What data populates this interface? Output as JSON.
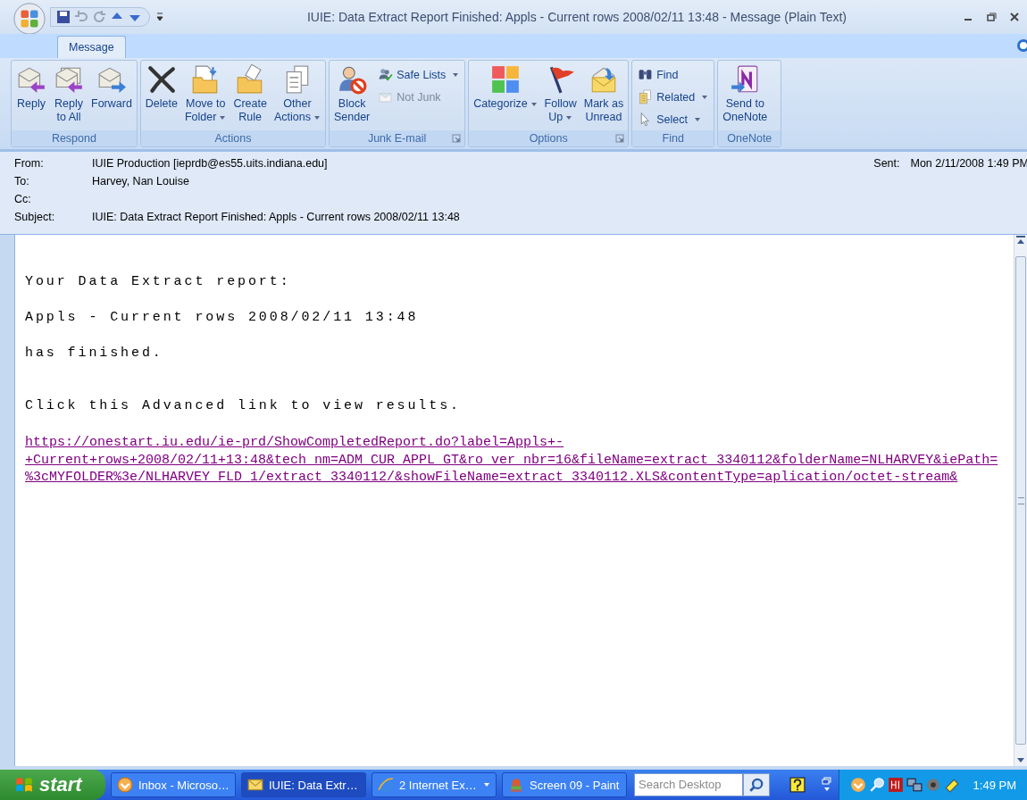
{
  "window": {
    "title": "IUIE: Data Extract Report Finished: Appls - Current rows 2008/02/11 13:48  - Message (Plain Text)"
  },
  "tabs": [
    {
      "label": "Message",
      "selected": true
    }
  ],
  "ribbon": [
    {
      "name": "Respond",
      "launcher": false,
      "buttons": [
        {
          "kind": "large",
          "label": "Reply",
          "disabled": false,
          "dropdown": false
        },
        {
          "kind": "large",
          "label": "Reply\nto All",
          "disabled": false,
          "dropdown": false
        },
        {
          "kind": "large",
          "label": "Forward",
          "disabled": false,
          "dropdown": false
        }
      ]
    },
    {
      "name": "Actions",
      "launcher": false,
      "buttons": [
        {
          "kind": "large",
          "label": "Delete",
          "disabled": false,
          "dropdown": false
        },
        {
          "kind": "large",
          "label": "Move to\nFolder",
          "disabled": false,
          "dropdown": true
        },
        {
          "kind": "large",
          "label": "Create\nRule",
          "disabled": false,
          "dropdown": false
        },
        {
          "kind": "large",
          "label": "Other\nActions",
          "disabled": false,
          "dropdown": true
        }
      ]
    },
    {
      "name": "Junk E-mail",
      "launcher": true,
      "buttons": [
        {
          "kind": "large",
          "label": "Block\nSender",
          "disabled": false,
          "dropdown": false
        },
        {
          "kind": "small",
          "label": "Safe Lists",
          "disabled": false,
          "dropdown": true
        },
        {
          "kind": "small",
          "label": "Not Junk",
          "disabled": true,
          "dropdown": false
        }
      ]
    },
    {
      "name": "Options",
      "launcher": true,
      "buttons": [
        {
          "kind": "large",
          "label": "Categorize",
          "disabled": false,
          "dropdown": true
        },
        {
          "kind": "large",
          "label": "Follow\nUp",
          "disabled": false,
          "dropdown": true
        },
        {
          "kind": "large",
          "label": "Mark as\nUnread",
          "disabled": false,
          "dropdown": false
        }
      ]
    },
    {
      "name": "Find",
      "launcher": false,
      "buttons": [
        {
          "kind": "small",
          "label": "Find",
          "disabled": false,
          "dropdown": false
        },
        {
          "kind": "small",
          "label": "Related",
          "disabled": false,
          "dropdown": true
        },
        {
          "kind": "small",
          "label": "Select",
          "disabled": false,
          "dropdown": true
        }
      ]
    },
    {
      "name": "OneNote",
      "launcher": false,
      "buttons": [
        {
          "kind": "large",
          "label": "Send to\nOneNote",
          "disabled": false,
          "dropdown": false
        }
      ]
    }
  ],
  "header": {
    "fields": [
      {
        "label": "From:",
        "value": "IUIE Production [ieprdb@es55.uits.indiana.edu]"
      },
      {
        "label": "To:",
        "value": "Harvey, Nan Louise"
      },
      {
        "label": "Cc:"
      },
      {
        "label": "Subject:",
        "value": "IUIE: Data Extract Report Finished: Appls - Current rows 2008/02/11 13:48"
      }
    ],
    "sent": {
      "label": "Sent:",
      "value": "Mon 2/11/2008 1:49 PM"
    }
  },
  "body": {
    "paragraphs": [
      {
        "kind": "text",
        "text": "Your Data Extract report:"
      },
      {
        "kind": "text",
        "text": "Appls - Current rows 2008/02/11 13:48"
      },
      {
        "kind": "text",
        "text": "has finished."
      },
      {
        "kind": "text",
        "text": "Click this Advanced link to view results."
      },
      {
        "kind": "link",
        "lines": [
          "https://onestart.iu.edu/ie-prd/ShowCompletedReport.do?label=Appls+-",
          "+Current+rows+2008/02/11+13:48&tech_nm=ADM_CUR_APPL_GT&ro_ver_nbr=16&fileName=extract_3340112&folderName=NLHARVEY&iePath=",
          "%3cMYFOLDER%3e/NLHARVEY_FLD_1/extract_3340112/&showFileName=extract_3340112.XLS&contentType=aplication/octet-stream&"
        ]
      }
    ]
  },
  "taskbar": {
    "start": "start",
    "items": [
      {
        "label": "Inbox - Microso…",
        "selected": false,
        "dropdown": false
      },
      {
        "label": "IUIE: Data Extr…",
        "selected": true,
        "dropdown": false
      },
      {
        "label": "2 Internet Ex…",
        "selected": false,
        "dropdown": true
      },
      {
        "label": "Screen 09 - Paint",
        "selected": false,
        "dropdown": false
      }
    ],
    "search": {
      "placeholder": "Search Desktop"
    },
    "clock": "1:49 PM"
  }
}
